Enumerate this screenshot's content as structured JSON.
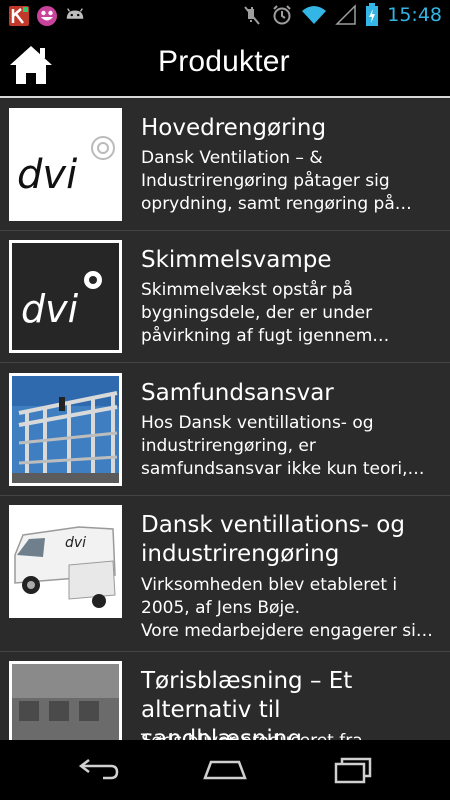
{
  "status_bar": {
    "time": "15:48",
    "left_icons": [
      "kaspersky-icon",
      "smiley-icon",
      "android-icon"
    ],
    "right_icons": [
      "mute-icon",
      "alarm-icon",
      "wifi-icon",
      "signal-icon",
      "battery-icon"
    ],
    "time_color": "#33b5e5"
  },
  "header": {
    "title": "Produkter"
  },
  "items": [
    {
      "title": "Hovedrengøring",
      "description": "Dansk Ventilation – &\nIndustrirengøring påtager sig\noprydning, samt rengøring på…",
      "thumb": "dvi-logo-white"
    },
    {
      "title": "Skimmelsvampe",
      "description": "Skimmelvækst opstår på\nbygningsdele, der er under\npåvirkning af fugt igennem…",
      "thumb": "dvi-logo-dark"
    },
    {
      "title": "Samfundsansvar",
      "description": "Hos Dansk ventillations- og\nindustrirengøring, er\nsamfundsansvar ikke kun teori,…",
      "thumb": "scaffolding-photo"
    },
    {
      "title": "Dansk ventillations- og\nindustrirengøring",
      "description": "Virksomheden blev etableret i\n2005, af Jens Bøje.\nVore medarbejdere engagerer si…",
      "thumb": "dvi-vans-photo"
    },
    {
      "title": "Tørisblæsning – Et\nalternativ til sandblæsning",
      "description": "Tøris bliver produceret fra",
      "thumb": "building-photo"
    }
  ],
  "nav_bar": {
    "icons": [
      "back-icon",
      "home-icon",
      "recent-apps-icon"
    ]
  }
}
